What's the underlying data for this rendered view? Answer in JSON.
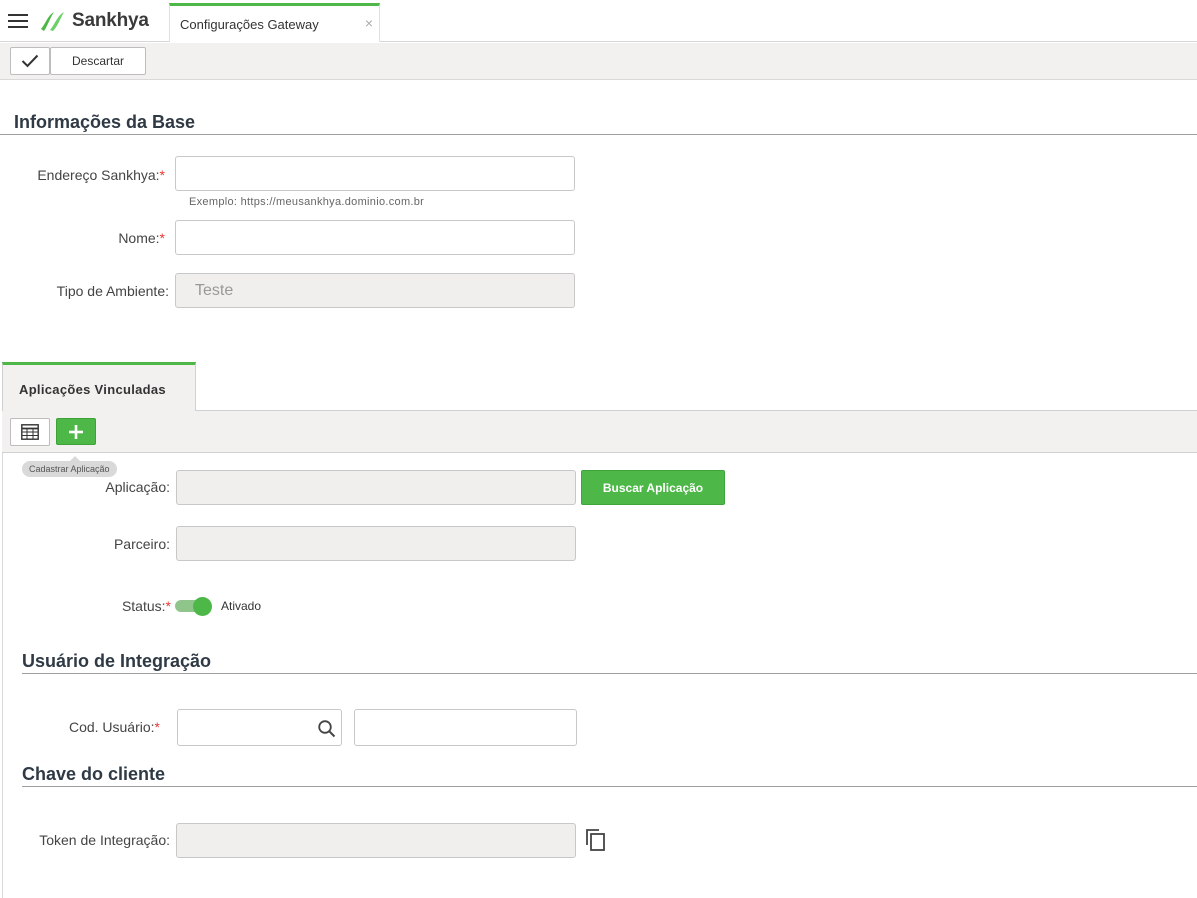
{
  "app": {
    "brand": "Sankhya",
    "tab_title": "Configurações Gateway",
    "tab_close": "×",
    "accent_color": "#4db848"
  },
  "toolbar": {
    "confirm_icon": "check-icon",
    "discard_label": "Descartar"
  },
  "base_section": {
    "title": "Informações da Base",
    "address_label": "Endereço Sankhya:",
    "address_value": "",
    "address_hint": "Exemplo: https://meusankhya.dominio.com.br",
    "name_label": "Nome:",
    "name_value": "",
    "env_label": "Tipo de Ambiente:",
    "env_value": "Teste",
    "required_mark": "*"
  },
  "linked_apps": {
    "tab_label": "Aplicações Vinculadas",
    "grid_icon": "table-grid-icon",
    "add_icon": "plus-icon",
    "add_tooltip": "Cadastrar Aplicação",
    "app_label": "Aplicação:",
    "app_value": "",
    "search_app_button": "Buscar Aplicação",
    "partner_label": "Parceiro:",
    "partner_value": "",
    "status_label": "Status:",
    "status_value": "Ativado"
  },
  "integration_user": {
    "title": "Usuário de Integração",
    "user_code_label": "Cod. Usuário:",
    "user_code_value": "",
    "user_name_value": ""
  },
  "client_key": {
    "title": "Chave do cliente",
    "token_label": "Token de Integração:",
    "token_value": "",
    "copy_icon": "copy-icon"
  }
}
